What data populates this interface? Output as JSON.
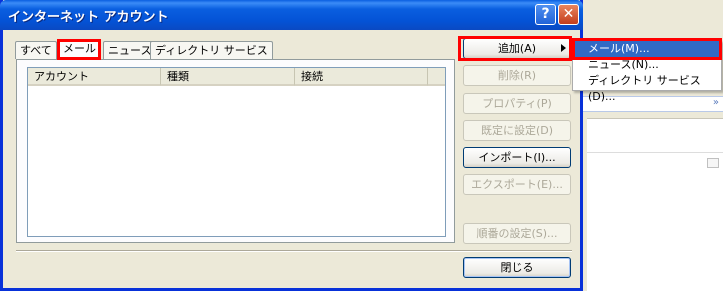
{
  "window": {
    "title": "インターネット アカウント",
    "help_glyph": "?",
    "close_glyph": "✕"
  },
  "tabs": [
    "すべて",
    "メール",
    "ニュース",
    "ディレクトリ サービス"
  ],
  "active_tab": "メール",
  "list": {
    "columns": [
      "アカウント",
      "種類",
      "接続"
    ]
  },
  "buttons": {
    "add": "追加(A)",
    "remove": "削除(R)",
    "properties": "プロパティ(P)",
    "set_default": "既定に設定(D)",
    "import": "インポート(I)...",
    "export": "エクスポート(E)...",
    "order": "順番の設定(S)...",
    "close": "閉じる"
  },
  "menu": {
    "items": [
      "メール(M)...",
      "ニュース(N)...",
      "ディレクトリ サービス(D)..."
    ]
  },
  "highlight_color": "#ff0000",
  "accent_color": "#0a5fe0"
}
